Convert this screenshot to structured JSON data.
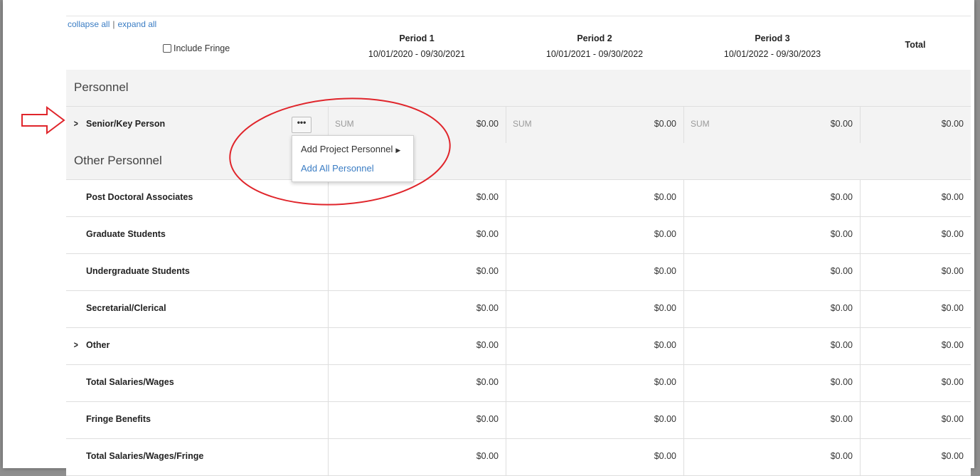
{
  "header": {
    "collapse_all": "collapse all",
    "separator": "|",
    "expand_all": "expand all",
    "include_fringe": "Include Fringe",
    "periods": [
      {
        "name": "Period 1",
        "dates": "10/01/2020 - 09/30/2021"
      },
      {
        "name": "Period 2",
        "dates": "10/01/2021 - 09/30/2022"
      },
      {
        "name": "Period 3",
        "dates": "10/01/2022 - 09/30/2023"
      }
    ],
    "total": "Total"
  },
  "sections": {
    "personnel": "Personnel",
    "other_personnel": "Other Personnel"
  },
  "senior_key": {
    "label": "Senior/Key Person",
    "more_button": "•••",
    "sum_label": "SUM",
    "values": [
      "$0.00",
      "$0.00",
      "$0.00",
      "$0.00"
    ]
  },
  "menu": {
    "add_project_personnel": "Add Project Personnel",
    "add_all_personnel": "Add All Personnel"
  },
  "rows": [
    {
      "label": "Post Doctoral Associates",
      "values": [
        "$0.00",
        "$0.00",
        "$0.00",
        "$0.00"
      ]
    },
    {
      "label": "Graduate Students",
      "values": [
        "$0.00",
        "$0.00",
        "$0.00",
        "$0.00"
      ]
    },
    {
      "label": "Undergraduate Students",
      "values": [
        "$0.00",
        "$0.00",
        "$0.00",
        "$0.00"
      ]
    },
    {
      "label": "Secretarial/Clerical",
      "values": [
        "$0.00",
        "$0.00",
        "$0.00",
        "$0.00"
      ]
    },
    {
      "label": "Other",
      "values": [
        "$0.00",
        "$0.00",
        "$0.00",
        "$0.00"
      ]
    },
    {
      "label": "Total Salaries/Wages",
      "values": [
        "$0.00",
        "$0.00",
        "$0.00",
        "$0.00"
      ]
    },
    {
      "label": "Fringe Benefits",
      "values": [
        "$0.00",
        "$0.00",
        "$0.00",
        "$0.00"
      ]
    },
    {
      "label": "Total Salaries/Wages/Fringe",
      "values": [
        "$0.00",
        "$0.00",
        "$0.00",
        "$0.00"
      ]
    }
  ],
  "colors": {
    "link": "#3b7dc4",
    "annotation": "#e0252b",
    "section_bg": "#f3f3f3"
  }
}
